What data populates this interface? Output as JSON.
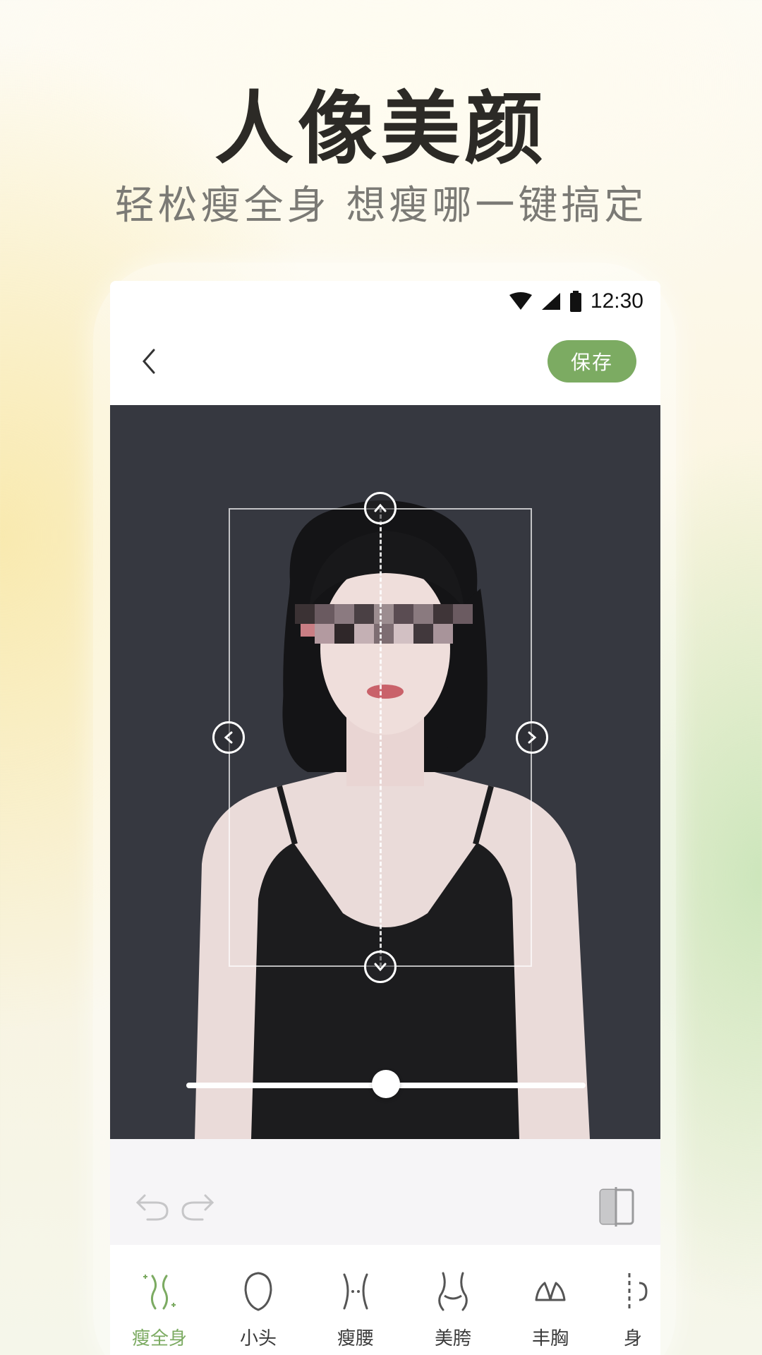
{
  "promo": {
    "headline": "人像美颜",
    "subline": "轻松瘦全身 想瘦哪一键搞定"
  },
  "status_bar": {
    "time": "12:30",
    "icons": [
      "wifi-icon",
      "signal-icon",
      "battery-icon"
    ]
  },
  "header": {
    "back_icon": "chevron-left-icon",
    "save_label": "保存"
  },
  "editor": {
    "slider_value": 0.5,
    "handles": [
      "up-arrow-icon",
      "down-arrow-icon",
      "left-arrow-icon",
      "right-arrow-icon"
    ]
  },
  "edit_bar": {
    "undo_icon": "undo-icon",
    "redo_icon": "redo-icon",
    "compare_icon": "compare-icon"
  },
  "tools": [
    {
      "label": "瘦全身",
      "icon": "body-slim-icon",
      "active": true
    },
    {
      "label": "小头",
      "icon": "small-head-icon",
      "active": false
    },
    {
      "label": "瘦腰",
      "icon": "waist-icon",
      "active": false
    },
    {
      "label": "美胯",
      "icon": "hip-icon",
      "active": false
    },
    {
      "label": "丰胸",
      "icon": "chest-icon",
      "active": false
    },
    {
      "label": "身",
      "icon": "height-icon",
      "active": false
    }
  ],
  "colors": {
    "accent": "#7cab62",
    "canvas_bg": "#363840"
  }
}
